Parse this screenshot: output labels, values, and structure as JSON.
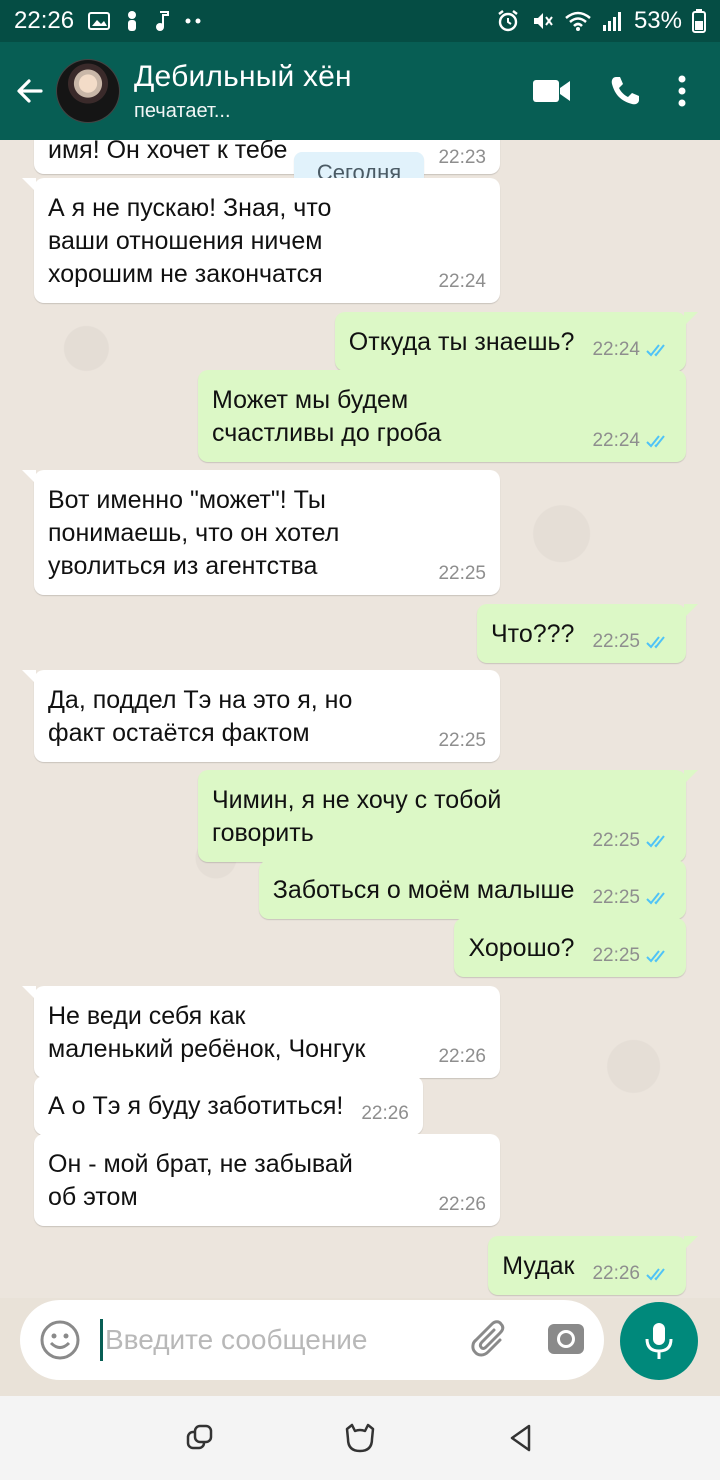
{
  "status_bar": {
    "time": "22:26",
    "left_icons": [
      "image-icon",
      "person-icon",
      "music-note-icon",
      "more-dots-icon"
    ],
    "right_icons": [
      "alarm-icon",
      "mute-icon",
      "wifi-icon",
      "signal-icon"
    ],
    "battery": "53%"
  },
  "header": {
    "contact_name": "Дебильный хён",
    "contact_status": "печатает...",
    "icons": [
      "back-arrow-icon",
      "video-call-icon",
      "phone-icon",
      "menu-icon"
    ]
  },
  "chat": {
    "date_separator": "Сегодня",
    "messages": [
      {
        "dir": "in",
        "text": "имя! Он хочет к тебе",
        "time": "22:23",
        "partial": true
      },
      {
        "dir": "in",
        "text": "А я не пускаю! Зная, что\nваши отношения ничем\nхорошим не закончатся",
        "time": "22:24"
      },
      {
        "dir": "out",
        "text": "Откуда ты знаешь?",
        "time": "22:24",
        "read": true
      },
      {
        "dir": "out",
        "text": "Может мы будем\nсчастливы до гроба",
        "time": "22:24",
        "read": true
      },
      {
        "dir": "in",
        "text": "Вот именно \"может\"! Ты\nпонимаешь, что он хотел\nуволиться из агентства",
        "time": "22:25"
      },
      {
        "dir": "out",
        "text": "Что???",
        "time": "22:25",
        "read": true
      },
      {
        "dir": "in",
        "text": "Да, поддел Тэ на это я, но\nфакт остаётся фактом",
        "time": "22:25"
      },
      {
        "dir": "out",
        "text": "Чимин, я не хочу с тобой\nговорить",
        "time": "22:25",
        "read": true
      },
      {
        "dir": "out",
        "text": "Заботься о моём малыше",
        "time": "22:25",
        "read": true
      },
      {
        "dir": "out",
        "text": "Хорошо?",
        "time": "22:25",
        "read": true
      },
      {
        "dir": "in",
        "text": "Не веди себя как\nмаленький ребёнок, Чонгук",
        "time": "22:26"
      },
      {
        "dir": "in",
        "text": "А о Тэ я буду заботиться!",
        "time": "22:26"
      },
      {
        "dir": "in",
        "text": "Он - мой брат, не забывай\nоб этом",
        "time": "22:26"
      },
      {
        "dir": "out",
        "text": "Мудак",
        "time": "22:26",
        "read": true
      }
    ]
  },
  "composer": {
    "placeholder": "Введите сообщение",
    "icons": [
      "emoji-icon",
      "attach-icon",
      "camera-icon",
      "mic-icon"
    ]
  },
  "navbar": {
    "icons": [
      "recent-apps-icon",
      "home-icon",
      "back-nav-icon"
    ]
  },
  "colors": {
    "header": "#075e54",
    "status_bar": "#054d44",
    "outgoing_bubble": "#dcf8c6",
    "incoming_bubble": "#ffffff",
    "read_ticks": "#4fc3f7",
    "mic_button": "#00897b"
  }
}
